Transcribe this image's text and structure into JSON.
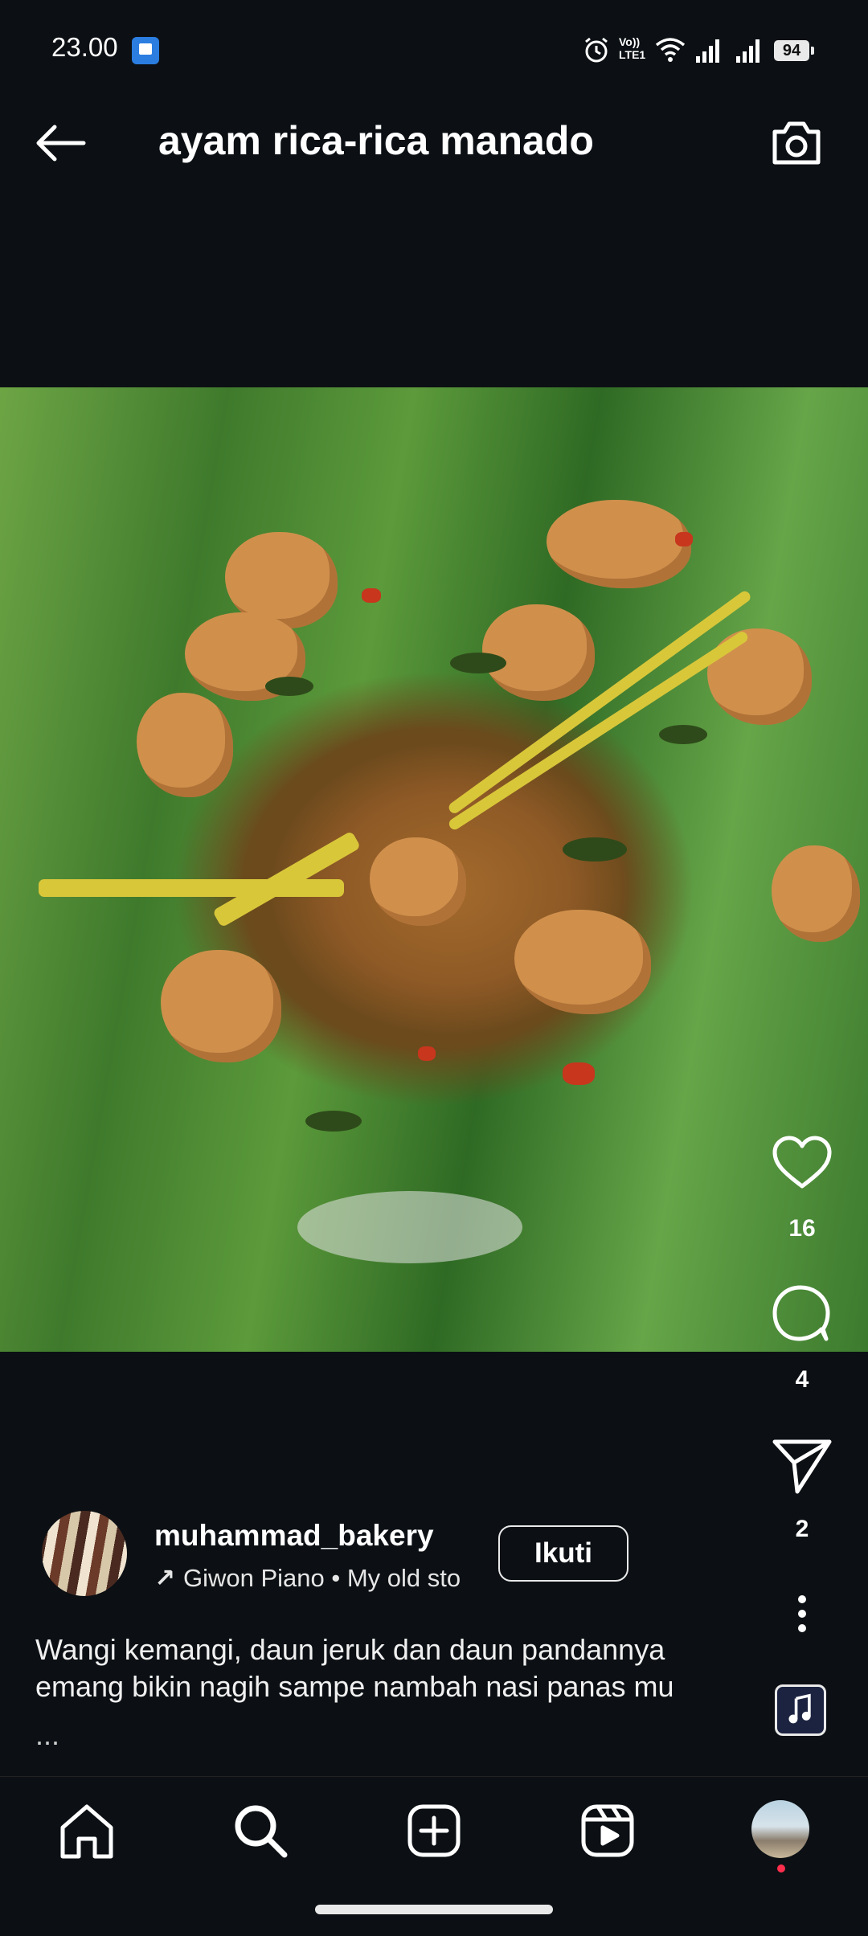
{
  "status_bar": {
    "time": "23.00",
    "battery": "94",
    "icons": [
      "app-notification-icon",
      "alarm-icon",
      "volte-icon",
      "wifi-icon",
      "signal-icon",
      "signal-icon",
      "battery-icon"
    ],
    "volte_label": "Vo)) LTE1"
  },
  "header": {
    "title": "ayam rica-rica manado",
    "back_icon": "arrow-left-icon",
    "camera_icon": "camera-icon"
  },
  "actions": {
    "like_count": "16",
    "comment_count": "4",
    "share_count": "2",
    "like_icon": "heart-icon",
    "comment_icon": "comment-bubble-icon",
    "share_icon": "paper-plane-icon",
    "more_icon": "more-vertical-icon",
    "audio_icon": "music-note-icon"
  },
  "post": {
    "username": "muhammad_bakery",
    "follow_label": "Ikuti",
    "music_arrow": "↗",
    "music_text": "Giwon Piano • My old sto",
    "caption": "Wangi kemangi, daun jeruk dan daun pandannya emang bikin nagih sampe nambah nasi panas mu",
    "caption_more": "..."
  },
  "bottom_nav": {
    "items": [
      "home-icon",
      "search-icon",
      "add-post-icon",
      "reels-icon",
      "profile-avatar"
    ]
  },
  "colors": {
    "background": "#0c1014",
    "text": "#f5f5f5",
    "notification_dot": "#ff2e4d"
  }
}
